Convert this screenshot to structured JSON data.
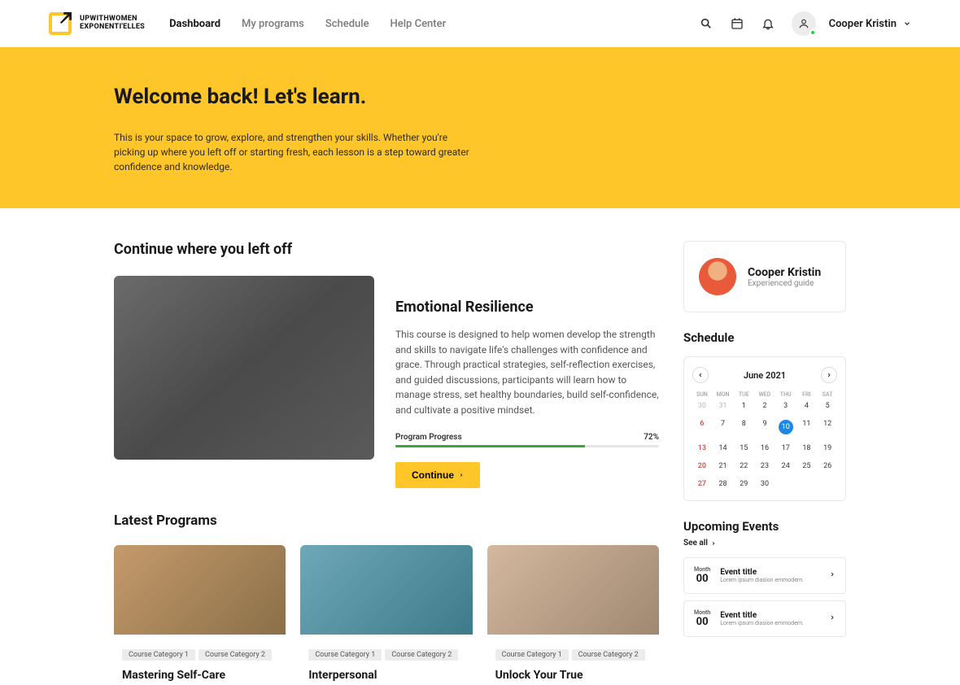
{
  "brand": {
    "line1": "UPWITHWOMEN",
    "line2": "EXPONENTI'ELLES"
  },
  "nav": [
    "Dashboard",
    "My programs",
    "Schedule",
    "Help Center"
  ],
  "user": {
    "name": "Cooper Kristin",
    "role": "Experienced guide"
  },
  "hero": {
    "title": "Welcome back! Let's learn.",
    "subtitle": "This is your space to grow, explore, and strengthen your skills. Whether you're picking up where you left off or starting fresh, each lesson is a step toward greater confidence and knowledge."
  },
  "continue": {
    "section_title": "Continue where you left off",
    "course_title": "Emotional Resilience",
    "desc": "This course is designed to help women develop the strength and skills to navigate life's challenges with confidence and grace. Through practical strategies, self-reflection exercises, and guided discussions, participants will learn how to manage stress, set healthy boundaries, build self-confidence, and cultivate a positive mindset.",
    "progress_label": "Program Progress",
    "progress_pct": "72%",
    "progress_fill": "72%",
    "button": "Continue"
  },
  "latest": {
    "title": "Latest Programs",
    "tag1": "Course Category  1",
    "tag2": "Course Category  2",
    "cards": [
      {
        "title": "Mastering Self-Care"
      },
      {
        "title": "Interpersonal"
      },
      {
        "title": "Unlock Your True"
      }
    ]
  },
  "schedule": {
    "title": "Schedule",
    "month": "June 2021",
    "days": [
      "SUN",
      "MON",
      "TUE",
      "WED",
      "THU",
      "FRI",
      "SAT"
    ]
  },
  "events": {
    "title": "Upcoming Events",
    "see_all": "See all",
    "item": {
      "month": "Month",
      "day": "00",
      "title": "Event title",
      "desc": "Lorem ipsum diasion emmodern."
    }
  }
}
